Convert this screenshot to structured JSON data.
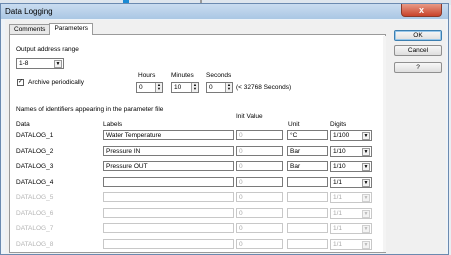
{
  "window": {
    "title": "Data Logging",
    "close_glyph": "x"
  },
  "tabs": [
    {
      "label": "Comments",
      "active": false
    },
    {
      "label": "Parameters",
      "active": true
    }
  ],
  "buttons": {
    "ok": "OK",
    "cancel": "Cancel",
    "help": "?"
  },
  "output": {
    "label": "Output address range",
    "value": "1-8"
  },
  "archive": {
    "label": "Archive periodically",
    "checked": true,
    "check_glyph": "✓"
  },
  "time": {
    "hours_label": "Hours",
    "minutes_label": "Minutes",
    "seconds_label": "Seconds",
    "hours": "0",
    "minutes": "10",
    "seconds": "0",
    "limit_note": "(< 32768 Seconds)"
  },
  "identifiers": {
    "caption": "Names of identifiers appearing in the parameter file",
    "headers": {
      "data": "Data",
      "labels": "Labels",
      "init_value": "Init Value",
      "unit": "Unit",
      "digits": "Digits"
    },
    "rows": [
      {
        "name": "DATALOG_1",
        "label": "Water Temperature",
        "init": "0",
        "unit": "°C",
        "digits": "1/100",
        "enabled": true
      },
      {
        "name": "DATALOG_2",
        "label": "Pressure IN",
        "init": "0",
        "unit": "Bar",
        "digits": "1/10",
        "enabled": true
      },
      {
        "name": "DATALOG_3",
        "label": "Pressure OUT",
        "init": "0",
        "unit": "Bar",
        "digits": "1/10",
        "enabled": true
      },
      {
        "name": "DATALOG_4",
        "label": "",
        "init": "0",
        "unit": "",
        "digits": "1/1",
        "enabled": true
      },
      {
        "name": "DATALOG_5",
        "label": "",
        "init": "0",
        "unit": "",
        "digits": "1/1",
        "enabled": false
      },
      {
        "name": "DATALOG_6",
        "label": "",
        "init": "0",
        "unit": "",
        "digits": "1/1",
        "enabled": false
      },
      {
        "name": "DATALOG_7",
        "label": "",
        "init": "0",
        "unit": "",
        "digits": "1/1",
        "enabled": false
      },
      {
        "name": "DATALOG_8",
        "label": "",
        "init": "0",
        "unit": "",
        "digits": "1/1",
        "enabled": false
      }
    ]
  },
  "icons": {
    "dropdown_arrow": "▼",
    "spin_up": "▲",
    "spin_down": "▼"
  }
}
